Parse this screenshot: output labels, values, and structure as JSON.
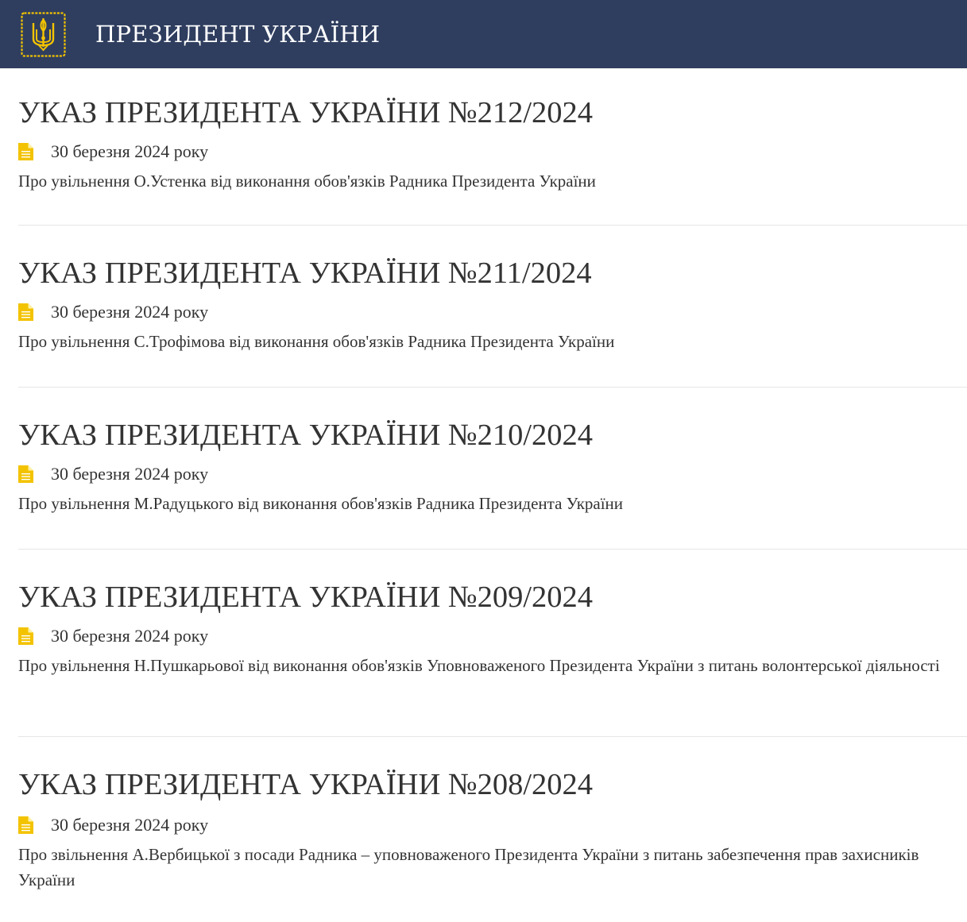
{
  "header": {
    "title": "ПРЕЗИДЕНТ УКРАЇНИ",
    "logo_icon": "trident-coat-of-arms-icon",
    "background_color": "#2f3e5f",
    "accent_color": "#f3c300"
  },
  "decrees": [
    {
      "title": "УКАЗ ПРЕЗИДЕНТА УКРАЇНИ №212/2024",
      "date": "30 березня 2024 року",
      "description": "Про увільнення О.Устенка від виконання обов'язків Радника Президента України"
    },
    {
      "title": "УКАЗ ПРЕЗИДЕНТА УКРАЇНИ №211/2024",
      "date": "30 березня 2024 року",
      "description": "Про увільнення С.Трофімова від виконання обов'язків Радника Президента України"
    },
    {
      "title": "УКАЗ ПРЕЗИДЕНТА УКРАЇНИ №210/2024",
      "date": "30 березня 2024 року",
      "description": "Про увільнення М.Радуцького від виконання обов'язків Радника Президента України"
    },
    {
      "title": "УКАЗ ПРЕЗИДЕНТА УКРАЇНИ №209/2024",
      "date": "30 березня 2024 року",
      "description": "Про увільнення Н.Пушкарьової від виконання обов'язків Уповноваженого Президента України з питань волонтерської діяльності"
    },
    {
      "title": "УКАЗ ПРЕЗИДЕНТА УКРАЇНИ №208/2024",
      "date": "30 березня 2024 року",
      "description": "Про звільнення А.Вербицької з посади Радника – уповноваженого Президента України з питань забезпечення прав захисників України"
    }
  ]
}
